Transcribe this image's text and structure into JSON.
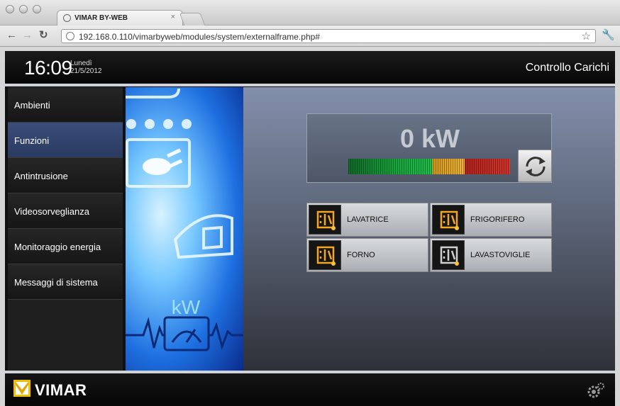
{
  "browser": {
    "tab_title": "VIMAR BY-WEB",
    "tab_close": "×",
    "url": "192.168.0.110/vimarbyweb/modules/system/externalframe.php#"
  },
  "header": {
    "time": "16:09",
    "day": "Lunedì",
    "date": "21/5/2012",
    "title": "Controllo Carichi"
  },
  "sidebar": {
    "items": [
      {
        "label": "Ambienti"
      },
      {
        "label": "Funzioni"
      },
      {
        "label": "Antintrusione"
      },
      {
        "label": "Videosorveglianza"
      },
      {
        "label": "Monitoraggio energia"
      },
      {
        "label": "Messaggi di sistema"
      }
    ]
  },
  "illustration": {
    "kw_label": "kW"
  },
  "meter": {
    "value": "0 kW"
  },
  "loads": [
    {
      "label": "LAVATRICE",
      "active": true
    },
    {
      "label": "FRIGORIFERO",
      "active": true
    },
    {
      "label": "FORNO",
      "active": true
    },
    {
      "label": "LAVASTOVIGLIE",
      "active": false
    }
  ],
  "footer": {
    "brand": "VIMAR"
  },
  "colors": {
    "accent_orange": "#f5a623",
    "active_menu": "#34477a"
  },
  "icons": [
    "back-icon",
    "forward-icon",
    "reload-icon",
    "star-icon",
    "wrench-icon",
    "refresh-icon",
    "load-icon",
    "vimar-logo-icon",
    "settings-gear-icon"
  ]
}
